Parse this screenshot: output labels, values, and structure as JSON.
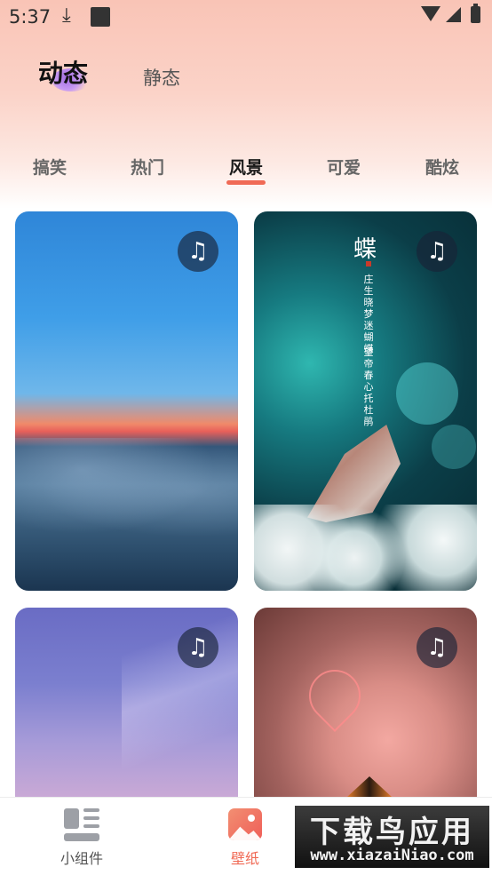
{
  "status_bar": {
    "time": "5:37",
    "download_icon": "download-arrow-icon",
    "notification_icon": "square-app-icon"
  },
  "mode_tabs": [
    {
      "label": "动态",
      "active": true
    },
    {
      "label": "静态",
      "active": false
    }
  ],
  "category_tabs": [
    {
      "label": "搞笑",
      "active": false
    },
    {
      "label": "热门",
      "active": false
    },
    {
      "label": "风景",
      "active": true
    },
    {
      "label": "可爱",
      "active": false
    },
    {
      "label": "酷炫",
      "active": false
    }
  ],
  "accent_color": "#f06a55",
  "wallpapers": [
    {
      "theme": "sky above clouds at sunset",
      "badge_icon": "music-note-icon"
    },
    {
      "theme": "butterfly on white flowers",
      "badge_icon": "music-note-icon",
      "overlay_title": "蝶",
      "overlay_poem_1": "庄生晓梦迷蝴蝶",
      "overlay_poem_2": "望帝春心托杜鹃"
    },
    {
      "theme": "starry purple sky",
      "badge_icon": "music-note-icon"
    },
    {
      "theme": "pink flowers with heart",
      "badge_icon": "music-note-icon"
    }
  ],
  "bottom_nav": [
    {
      "label": "小组件",
      "icon": "widget-grid-icon",
      "active": false
    },
    {
      "label": "壁纸",
      "icon": "wallpaper-image-icon",
      "active": true
    }
  ],
  "watermark": {
    "title": "下载鸟应用",
    "url": "www.xiazaiNiao.com"
  }
}
